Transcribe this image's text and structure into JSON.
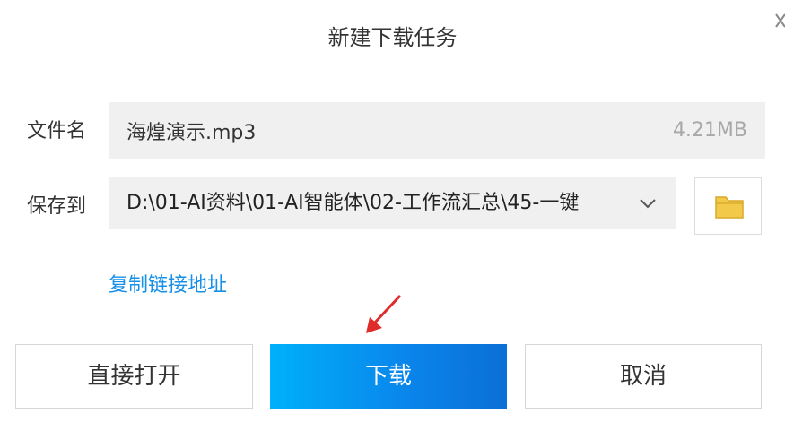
{
  "dialog": {
    "title": "新建下载任务"
  },
  "file": {
    "label": "文件名",
    "name": "海煌演示.mp3",
    "size": "4.21MB"
  },
  "save": {
    "label": "保存到",
    "path": "D:\\01-AI资料\\01-AI智能体\\02-工作流汇总\\45-一键"
  },
  "links": {
    "copy_link": "复制链接地址"
  },
  "buttons": {
    "open_directly": "直接打开",
    "download": "下载",
    "cancel": "取消"
  },
  "colors": {
    "accent": "#0a84ea",
    "link": "#1890e8",
    "arrow": "#e02b2b",
    "folder": "#f3c94a"
  },
  "icons": {
    "close": "close-icon",
    "chevron": "chevron-down-icon",
    "folder": "folder-icon",
    "arrow": "red-arrow-annotation"
  }
}
